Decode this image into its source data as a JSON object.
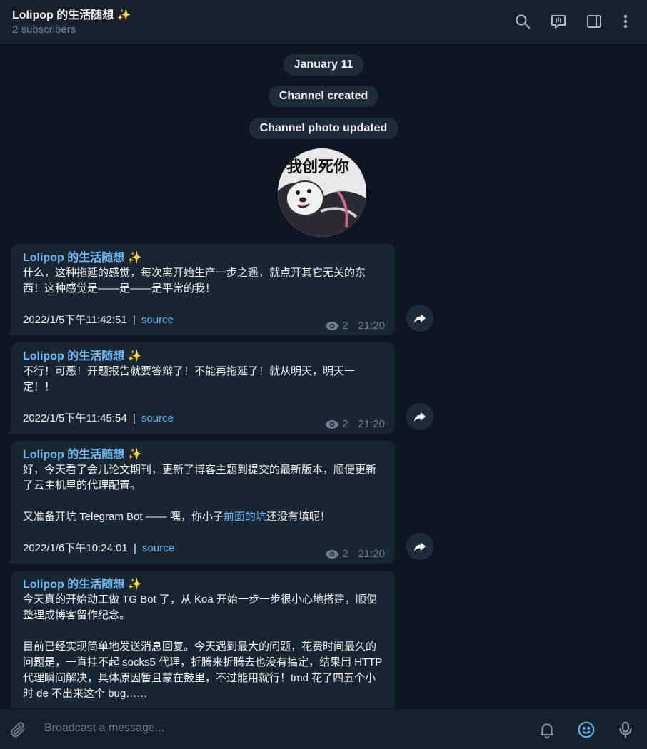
{
  "header": {
    "title": "Lolipop 的生活随想 ✨",
    "subtitle": "2 subscribers",
    "icons": [
      "search-icon",
      "comments-icon",
      "sidebar-toggle-icon",
      "more-icon"
    ]
  },
  "service_messages": {
    "date": "January 11",
    "created": "Channel created",
    "photo_updated": "Channel photo updated"
  },
  "channel_photo": {
    "caption": "我创死你"
  },
  "messages": [
    {
      "author": "Lolipop 的生活随想 ✨",
      "text": "什么，这种拖延的感觉，每次离开始生产一步之遥，就点开其它无关的东西！这种感觉是——是——是平常的我！",
      "posted": "2022/1/5下午11:42:51",
      "separator": "|",
      "source": "source",
      "views": "2",
      "time": "21:20"
    },
    {
      "author": "Lolipop 的生活随想 ✨",
      "text": "不行！可恶！开题报告就要答辩了！不能再拖延了！就从明天，明天一定！！",
      "posted": "2022/1/5下午11:45:54",
      "separator": "|",
      "source": "source",
      "views": "2",
      "time": "21:20"
    },
    {
      "author": "Lolipop 的生活随想 ✨",
      "text1": "好，今天看了会儿论文期刊，更新了博客主题到提交的最新版本，顺便更新了云主机里的代理配置。",
      "text2_pre": "又准备开坑 Telegram Bot —— 嘿，你小子",
      "text2_link": "前面的坑",
      "text2_post": "还没有填呢！",
      "posted": "2022/1/6下午10:24:01",
      "separator": "|",
      "source": "source",
      "views": "2",
      "time": "21:20"
    },
    {
      "author": "Lolipop 的生活随想 ✨",
      "text1": "今天真的开始动工做 TG Bot 了，从 Koa 开始一步一步很小心地搭建，顺便整理成博客留作纪念。",
      "text2": "目前已经实现简单地发送消息回复。今天遇到最大的问题，花费时间最久的问题是，一直挂不起 socks5 代理，折腾来折腾去也没有搞定，结果用 HTTP 代理瞬间解决，具体原因暂且蒙在鼓里，不过能用就行！tmd 花了四五个小时 de 不出来这个 bug……"
    }
  ],
  "footer": {
    "placeholder": "Broadcast a message...",
    "icons": [
      "attach-icon",
      "bell-icon",
      "emoji-icon",
      "microphone-icon"
    ]
  },
  "colors": {
    "background": "#0e1621",
    "header": "#17212b",
    "bubble": "#182533",
    "author": "#71baf2",
    "link": "#6ab3f3"
  }
}
